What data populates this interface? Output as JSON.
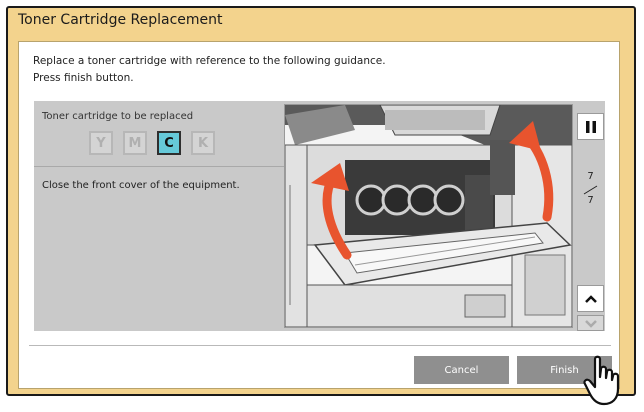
{
  "dialog": {
    "title": "Toner Cartridge Replacement"
  },
  "instructions": {
    "line1": "Replace a toner cartridge with reference to the following guidance.",
    "line2": "Press finish button."
  },
  "toner": {
    "label": "Toner cartridge to be replaced",
    "cartridges": [
      {
        "letter": "Y",
        "active": false
      },
      {
        "letter": "M",
        "active": false
      },
      {
        "letter": "C",
        "active": true
      },
      {
        "letter": "K",
        "active": false
      }
    ]
  },
  "step": {
    "text": "Close the front cover of the equipment.",
    "current": "7",
    "total": "7"
  },
  "controls": {
    "pause_icon": "pause-icon",
    "up_icon": "chevron-up-icon",
    "down_icon": "chevron-down-icon"
  },
  "buttons": {
    "cancel": "Cancel",
    "finish": "Finish"
  },
  "colors": {
    "dialog_bg": "#f3d38d",
    "active_cartridge": "#66c9d9",
    "arrow": "#e8542e",
    "button": "#8f8f8f"
  }
}
